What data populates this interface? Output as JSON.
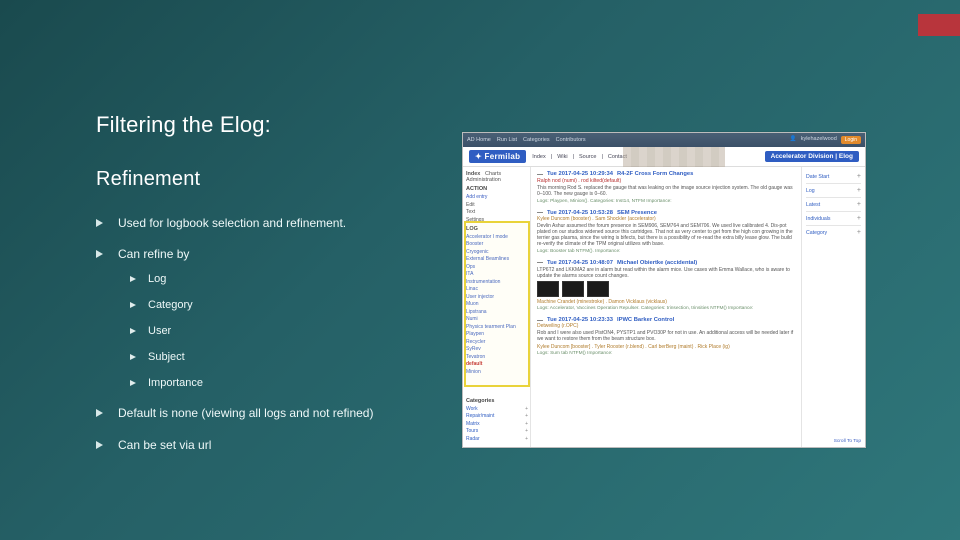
{
  "slide": {
    "title": "Filtering the Elog:",
    "subtitle": "Refinement",
    "bullets": [
      {
        "text": "Used for logbook selection and refinement."
      },
      {
        "text": "Can refine by",
        "children": [
          "Log",
          "Category",
          "User",
          "Subject",
          "Importance"
        ]
      },
      {
        "text": "Default is none (viewing all logs and not refined)"
      },
      {
        "text": "Can be set via url"
      }
    ]
  },
  "screenshot": {
    "topnav": [
      "AD Home",
      "Run List",
      "Categories",
      "Contributors"
    ],
    "login_user": "kylehazelwood",
    "login_btn": "Login",
    "brand": "Fermilab",
    "brand_tabs": [
      "Index",
      "Wiki",
      "Source",
      "Contact"
    ],
    "right_pill": "Accelerator Division | Elog",
    "page_tabs": [
      "Index",
      "Charts",
      "Administration"
    ],
    "action_header": "ACTION",
    "action_items": [
      "Add entry",
      "Edit",
      "Text",
      "Settings"
    ],
    "log_header": "LOG",
    "log_items": [
      "Accelerator I mode",
      "Booster",
      "Cryogenic",
      "External Beamlines",
      "Ops",
      "ITA",
      "Instrumentation",
      "Linac",
      "User injector",
      "Muon",
      "Lipstrana",
      "Numi",
      "Physics tearment Plan",
      "Playpen",
      "Recycler",
      "SyRev",
      "Tevatron",
      "default",
      "Minion"
    ],
    "categories_header": "Categories",
    "cat_items": [
      "Work",
      "Repair/maint",
      "Matrix",
      "Tours",
      "Radar"
    ],
    "right_items": [
      "Date Start",
      "Log",
      "Latest",
      "Individuals",
      "Category"
    ],
    "entries": [
      {
        "time": "Tue 2017-04-25 10:29:34",
        "who": "R4-2F Cross Form Changes",
        "sub": "Ralph nod (numi) . rod kilted(default)",
        "body": "This morning Rod S. replaced the gauge that was leaking on the image source injection system. The old gauge was 0–100. The new gauge is 0–60.",
        "tags": "Logs: Playpen, Minion(). Categories: Inst14, NTFM Importance:"
      },
      {
        "time": "Tue 2017-04-25 10:53:28",
        "who": "SEM Presence",
        "meta": "Kylee Duncom (booster) . Sam Shockler (accelerator)",
        "body": "Devlin Ashur assumed the forum presence in SEM906, SEM764 and SEM706. We used live calibrated 4. Dis-pot plated on our studios widened source this cartridges. That not as very center to get from the high con growing in the terrier gas plasma, since the wiring is bifects, but there is a possibility of re-read the extra billy lease glow. The build re-verify the climate of the TPM original utilizes with base.",
        "tags": "Logs: Booster tab  NTFM(). Importance:"
      },
      {
        "time": "Tue 2017-04-25 10:48:07",
        "who": "Michael Obiertke (accidental)",
        "body": "LTP6T2 and LKKMA2 are in alarm but read within the alarm mice. Use cases with Emma Wallace, who is aware to update the alarms source count changes.",
        "thumbs": true,
        "meta2": "Machine Crandet (minestroke) . Damon Vicklaus (vicklaus)",
        "tags": "Logs: Accelerator, Vaccines Operation Repulser. Categories: trinsection, trinsities  NTFM()  Importance:"
      },
      {
        "time": "Tue 2017-04-25 10:23:33",
        "who": "IPWC Barker Control",
        "meta": "Detweiling (r.OPC)",
        "meta2": "Kylee Duncom [booster] . Tyler Rooster (r.blend) . Carl berBerg (maint) . Rick Place (ig)",
        "body": "Rob and I were also used PistON4, PYSTP1 and PVO30P for not in use. An additional access will be needed later if we want to restore them from the beam structure box.",
        "tags": "Logs: Sum tab  NTFM()  Importance:"
      }
    ],
    "scroll_top": "Scroll To Top"
  }
}
